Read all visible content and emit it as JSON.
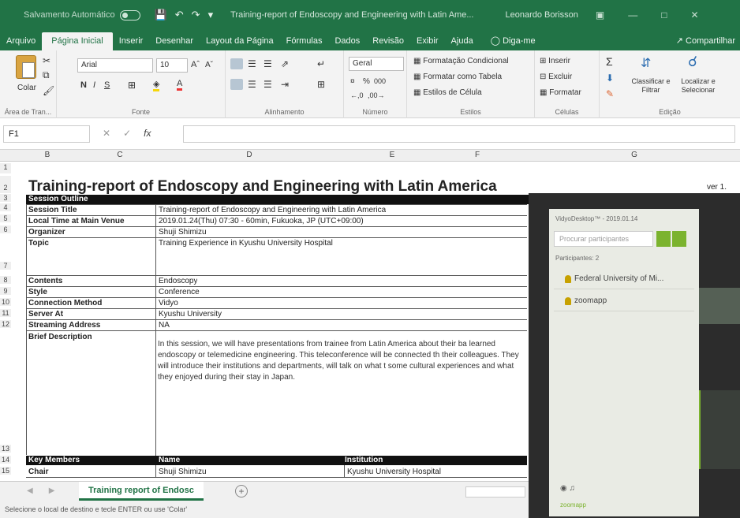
{
  "titlebar": {
    "autosave": "Salvamento Automático",
    "doc_title": "Training-report of Endoscopy and Engineering with Latin Ame...",
    "user": "Leonardo Borisson"
  },
  "tabs": [
    "Arquivo",
    "Página Inicial",
    "Inserir",
    "Desenhar",
    "Layout da Página",
    "Fórmulas",
    "Dados",
    "Revisão",
    "Exibir",
    "Ajuda"
  ],
  "tell_me": "Diga-me",
  "share": "Compartilhar",
  "ribbon": {
    "clipboard_label": "Área de Tran...",
    "paste": "Colar",
    "font_name": "Arial",
    "font_size": "10",
    "font_label": "Fonte",
    "align_label": "Alinhamento",
    "number_format": "Geral",
    "number_label": "Número",
    "cond_format": "Formatação Condicional",
    "format_table": "Formatar como Tabela",
    "cell_styles": "Estilos de Célula",
    "styles_label": "Estilos",
    "insert": "Inserir",
    "delete": "Excluir",
    "format": "Formatar",
    "cells_label": "Células",
    "sort_filter": "Classificar e Filtrar",
    "find_select": "Localizar e Selecionar",
    "edit_label": "Edição"
  },
  "formula_bar": {
    "name_box": "F1",
    "fx": "fx"
  },
  "columns": [
    "B",
    "C",
    "D",
    "E",
    "F",
    "G"
  ],
  "sheet": {
    "title": "Training-report of Endoscopy and Engineering with Latin America",
    "version": "ver 1.",
    "session_outline": "Session Outline",
    "rows": [
      {
        "label": "Session Title",
        "value": "Training-report of Endoscopy and Engineering with Latin America"
      },
      {
        "label": "Local Time at Main Venue",
        "value": "2019.01.24(Thu) 07:30 - 60min, Fukuoka, JP (UTC+09:00)"
      },
      {
        "label": "Organizer",
        "value": "Shuji Shimizu"
      },
      {
        "label": "Topic",
        "value": "Training Experience in Kyushu University Hospital"
      },
      {
        "label": "Contents",
        "value": "Endoscopy"
      },
      {
        "label": "Style",
        "value": "Conference"
      },
      {
        "label": "Connection Method",
        "value": "Vidyo"
      },
      {
        "label": "Server At",
        "value": "Kyushu University"
      },
      {
        "label": "Streaming Address",
        "value": "NA"
      },
      {
        "label": "Brief Description",
        "value": "In this session, we will have presentations from trainee from Latin America about their ba learned endoscopy or telemedicine engineering. This teleconference will be connected th their colleagues. They will introduce their institutions and departments, will talk on what t some cultural experiences and what they enjoyed during their stay in Japan."
      }
    ],
    "key_members": "Key Members",
    "name_hdr": "Name",
    "institution_hdr": "Institution",
    "chair_label": "Chair",
    "chair_name": "Shuji Shimizu",
    "chair_inst": "Kyushu University Hospital"
  },
  "overlay": {
    "title": "VidyoDesktop™ - 2019.01.14",
    "search_placeholder": "Procurar participantes",
    "count": "Participantes: 2",
    "participants": [
      "Federal University of Mi...",
      "zoomapp"
    ],
    "bottom": "zoomapp"
  },
  "sheet_tab": "Training report of Endosc",
  "status": "Selecione o local de destino e tecle ENTER ou use 'Colar'"
}
